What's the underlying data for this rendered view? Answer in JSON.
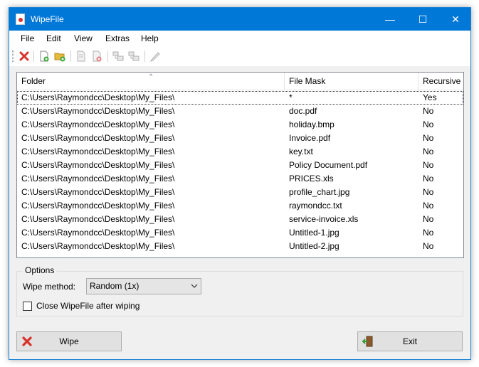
{
  "window": {
    "title": "WipeFile"
  },
  "titlebar_controls": {
    "minimize": "—",
    "maximize": "☐",
    "close": "✕"
  },
  "menu": [
    "File",
    "Edit",
    "View",
    "Extras",
    "Help"
  ],
  "toolbar": {
    "icons": [
      "delete-icon",
      "new-file-icon",
      "new-folder-icon",
      "copy-icon",
      "remove-icon",
      "move-up-icon",
      "move-down-icon",
      "edit-icon"
    ]
  },
  "list": {
    "columns": [
      "Folder",
      "File Mask",
      "Recursive"
    ],
    "rows": [
      {
        "folder": "C:\\Users\\Raymondcc\\Desktop\\My_Files\\",
        "mask": "*",
        "recursive": "Yes"
      },
      {
        "folder": "C:\\Users\\Raymondcc\\Desktop\\My_Files\\",
        "mask": "doc.pdf",
        "recursive": "No"
      },
      {
        "folder": "C:\\Users\\Raymondcc\\Desktop\\My_Files\\",
        "mask": "holiday.bmp",
        "recursive": "No"
      },
      {
        "folder": "C:\\Users\\Raymondcc\\Desktop\\My_Files\\",
        "mask": "Invoice.pdf",
        "recursive": "No"
      },
      {
        "folder": "C:\\Users\\Raymondcc\\Desktop\\My_Files\\",
        "mask": "key.txt",
        "recursive": "No"
      },
      {
        "folder": "C:\\Users\\Raymondcc\\Desktop\\My_Files\\",
        "mask": "Policy Document.pdf",
        "recursive": "No"
      },
      {
        "folder": "C:\\Users\\Raymondcc\\Desktop\\My_Files\\",
        "mask": "PRICES.xls",
        "recursive": "No"
      },
      {
        "folder": "C:\\Users\\Raymondcc\\Desktop\\My_Files\\",
        "mask": "profile_chart.jpg",
        "recursive": "No"
      },
      {
        "folder": "C:\\Users\\Raymondcc\\Desktop\\My_Files\\",
        "mask": "raymondcc.txt",
        "recursive": "No"
      },
      {
        "folder": "C:\\Users\\Raymondcc\\Desktop\\My_Files\\",
        "mask": "service-invoice.xls",
        "recursive": "No"
      },
      {
        "folder": "C:\\Users\\Raymondcc\\Desktop\\My_Files\\",
        "mask": "Untitled-1.jpg",
        "recursive": "No"
      },
      {
        "folder": "C:\\Users\\Raymondcc\\Desktop\\My_Files\\",
        "mask": "Untitled-2.jpg",
        "recursive": "No"
      }
    ]
  },
  "options": {
    "label": "Options",
    "wipe_method_label": "Wipe method:",
    "wipe_method_value": "Random (1x)",
    "close_after_label": "Close WipeFile after wiping",
    "close_after_checked": false
  },
  "buttons": {
    "wipe": "Wipe",
    "exit": "Exit"
  },
  "colors": {
    "titlebar": "#0078d7",
    "window_bg": "#f0f0f0",
    "delete_red": "#d9312b"
  }
}
